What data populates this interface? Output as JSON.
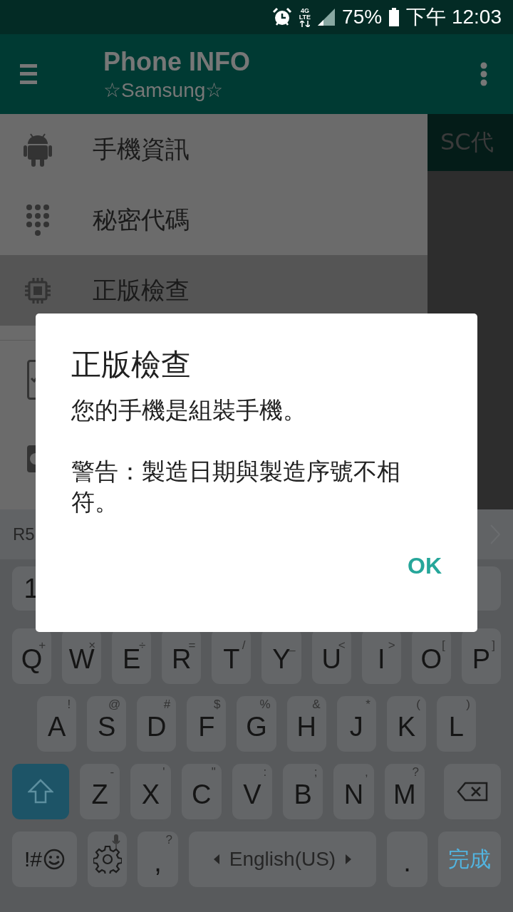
{
  "status_bar": {
    "network": [
      "4G",
      "LTE"
    ],
    "battery": "75%",
    "time": "下午 12:03"
  },
  "app_bar": {
    "title": "Phone INFO",
    "subtitle": "☆Samsung☆"
  },
  "drawer": {
    "items": [
      {
        "label": "手機資訊",
        "selected": false,
        "kind": "android"
      },
      {
        "label": "秘密代碼",
        "selected": false,
        "kind": "dialpad"
      },
      {
        "label": "正版檢查",
        "selected": true,
        "kind": "chip"
      }
    ]
  },
  "background": {
    "tab_label": "SC代"
  },
  "keyboard": {
    "suggestion": "R5",
    "number_keys": [
      "1"
    ],
    "rows": [
      {
        "keys": [
          {
            "kind": "char",
            "label": "Q",
            "hint": "+"
          },
          {
            "kind": "char",
            "label": "W",
            "hint": "×"
          },
          {
            "kind": "char",
            "label": "E",
            "hint": "÷"
          },
          {
            "kind": "char",
            "label": "R",
            "hint": "="
          },
          {
            "kind": "char",
            "label": "T",
            "hint": "/"
          },
          {
            "kind": "char",
            "label": "Y",
            "hint": "_"
          },
          {
            "kind": "char",
            "label": "U",
            "hint": "<"
          },
          {
            "kind": "char",
            "label": "I",
            "hint": ">"
          },
          {
            "kind": "char",
            "label": "O",
            "hint": "["
          },
          {
            "kind": "char",
            "label": "P",
            "hint": "]"
          }
        ]
      },
      {
        "keys": [
          {
            "kind": "char",
            "label": "A",
            "hint": "!"
          },
          {
            "kind": "char",
            "label": "S",
            "hint": "@"
          },
          {
            "kind": "char",
            "label": "D",
            "hint": "#"
          },
          {
            "kind": "char",
            "label": "F",
            "hint": "$"
          },
          {
            "kind": "char",
            "label": "G",
            "hint": "%"
          },
          {
            "kind": "char",
            "label": "H",
            "hint": "&"
          },
          {
            "kind": "char",
            "label": "J",
            "hint": "*"
          },
          {
            "kind": "char",
            "label": "K",
            "hint": "("
          },
          {
            "kind": "char",
            "label": "L",
            "hint": ")"
          }
        ]
      },
      {
        "keys": [
          {
            "kind": "shift",
            "active": true
          },
          {
            "kind": "char",
            "label": "Z",
            "hint": "-"
          },
          {
            "kind": "char",
            "label": "X",
            "hint": "'"
          },
          {
            "kind": "char",
            "label": "C",
            "hint": "\""
          },
          {
            "kind": "char",
            "label": "V",
            "hint": ":"
          },
          {
            "kind": "char",
            "label": "B",
            "hint": ";"
          },
          {
            "kind": "char",
            "label": "N",
            "hint": ","
          },
          {
            "kind": "char",
            "label": "M",
            "hint": "?"
          },
          {
            "kind": "backspace"
          }
        ]
      },
      {
        "keys": [
          {
            "kind": "symbols",
            "label": "!#"
          },
          {
            "kind": "settings"
          },
          {
            "kind": "char",
            "label": ",",
            "hint": "?"
          },
          {
            "kind": "space",
            "label": "English(US)"
          },
          {
            "kind": "char",
            "label": "."
          },
          {
            "kind": "done",
            "label": "完成"
          }
        ]
      }
    ]
  },
  "dialog": {
    "title": "正版檢查",
    "message": "您的手機是組裝手機。",
    "warning": "警告：製造日期與製造序號不相符。",
    "button": "OK"
  }
}
